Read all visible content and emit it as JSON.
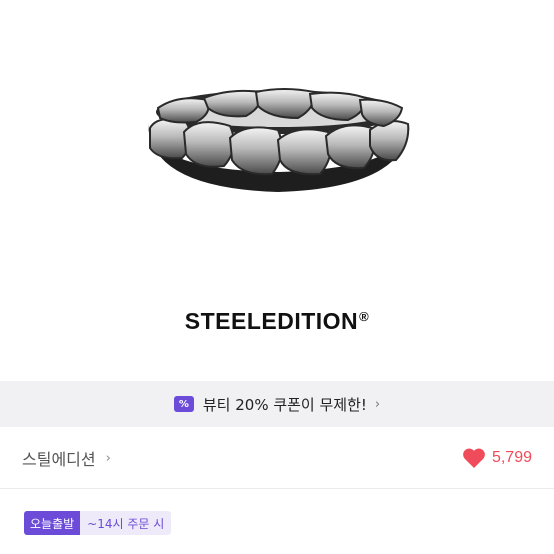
{
  "product": {
    "brand_logo_text": "STEELEDITION",
    "brand_logo_mark": "®",
    "image_subject": "ring-icon"
  },
  "coupon": {
    "icon_text": "%",
    "text": "뷰티 20% 쿠폰이 무제한!",
    "chevron": "›"
  },
  "store": {
    "name": "스틸에디션",
    "chevron": "›",
    "like_count": "5,799"
  },
  "delivery": {
    "badge": "오늘출발",
    "cutoff": "~14시 주문 시"
  },
  "colors": {
    "accent": "#6b4bd8",
    "heart": "#f04b5a",
    "coupon_bg": "#f1f1f3"
  }
}
